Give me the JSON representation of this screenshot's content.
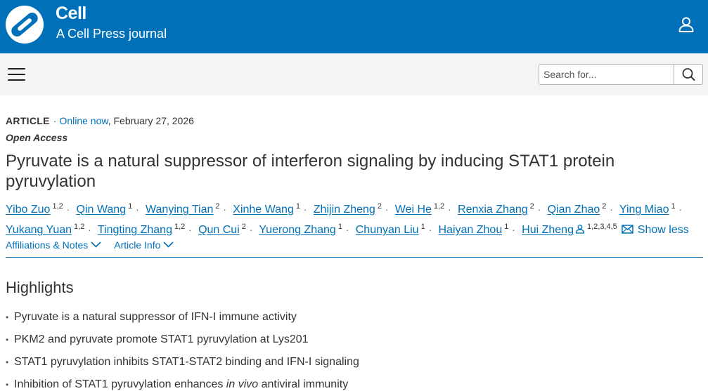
{
  "header": {
    "brand": "Cell",
    "tagline": "A Cell Press journal",
    "colors": {
      "brand_blue": "#0071b8",
      "nav_gray": "#f4f4f4"
    },
    "icons": {
      "logo": "cell-press-logo",
      "user": "user-icon"
    }
  },
  "nav": {
    "menu_icon": "hamburger-menu-icon",
    "search": {
      "placeholder": "Search for...",
      "icon": "search-icon"
    }
  },
  "article": {
    "type": "ARTICLE",
    "status": "Online now",
    "date": ", February 27, 2026",
    "open_access": "Open Access",
    "title": "Pyruvate is a natural suppressor of interferon signaling by inducing STAT1 protein pyruvylation",
    "authors": [
      {
        "name": "Yibo Zuo",
        "aff": "1,2"
      },
      {
        "name": "Qin Wang",
        "aff": "1"
      },
      {
        "name": "Wanying Tian",
        "aff": "2"
      },
      {
        "name": "Xinhe Wang",
        "aff": "1"
      },
      {
        "name": "Zhijin Zheng",
        "aff": "2"
      },
      {
        "name": "Wei He",
        "aff": "1,2"
      },
      {
        "name": "Renxia Zhang",
        "aff": "2"
      },
      {
        "name": "Qian Zhao",
        "aff": "2"
      },
      {
        "name": "Ying Miao",
        "aff": "1"
      },
      {
        "name": "Yukang Yuan",
        "aff": "1,2"
      },
      {
        "name": "Tingting Zhang",
        "aff": "1,2"
      },
      {
        "name": "Qun Cui",
        "aff": "2"
      },
      {
        "name": "Yuerong Zhang",
        "aff": "1"
      },
      {
        "name": "Chunyan Liu",
        "aff": "1"
      },
      {
        "name": "Haiyan Zhou",
        "aff": "1"
      },
      {
        "name": "Hui Zheng",
        "aff": "1,2,3,4,5"
      }
    ],
    "show_less": "Show less",
    "tabs": [
      {
        "label": "Affiliations & Notes"
      },
      {
        "label": "Article Info"
      }
    ]
  },
  "highlights": {
    "heading": "Highlights",
    "items": [
      {
        "text": "Pyruvate is a natural suppressor of IFN-I immune activity"
      },
      {
        "text": "PKM2 and pyruvate promote STAT1 pyruvylation at Lys201"
      },
      {
        "text": "STAT1 pyruvylation inhibits STAT1-STAT2 binding and IFN-I signaling"
      },
      {
        "before": "Inhibition of STAT1 pyruvylation enhances ",
        "italic": "in vivo",
        "after": " antiviral immunity"
      }
    ]
  }
}
